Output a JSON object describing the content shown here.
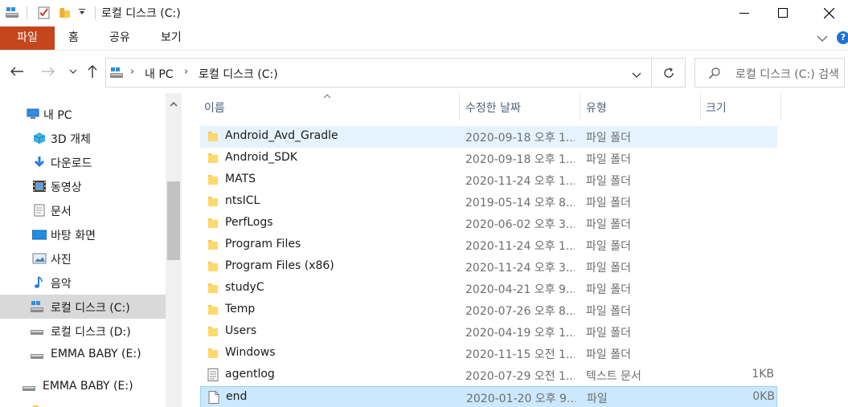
{
  "window": {
    "title": "로컬 디스크 (C:)",
    "accent_color": "#c5461c"
  },
  "ribbon": {
    "tabs": [
      "파일",
      "홈",
      "공유",
      "보기"
    ]
  },
  "address": {
    "breadcrumbs": [
      "내 PC",
      "로컬 디스크 (C:)"
    ],
    "search_placeholder": "로컬 디스크 (C:) 검색"
  },
  "nav": {
    "items": [
      {
        "label": "내 PC",
        "icon": "pc-icon"
      },
      {
        "label": "3D 개체",
        "icon": "3d-objects-icon"
      },
      {
        "label": "다운로드",
        "icon": "download-icon"
      },
      {
        "label": "동영상",
        "icon": "video-icon"
      },
      {
        "label": "문서",
        "icon": "document-icon"
      },
      {
        "label": "바탕 화면",
        "icon": "desktop-icon"
      },
      {
        "label": "사진",
        "icon": "picture-icon"
      },
      {
        "label": "음악",
        "icon": "music-icon"
      },
      {
        "label": "로컬 디스크 (C:)",
        "icon": "windows-drive-icon"
      },
      {
        "label": "로컬 디스크 (D:)",
        "icon": "drive-icon"
      },
      {
        "label": "EMMA BABY (E:)",
        "icon": "drive-icon"
      },
      {
        "label": "EMMA BABY (E:)",
        "icon": "drive-icon"
      }
    ]
  },
  "list": {
    "columns": [
      "이름",
      "수정한 날짜",
      "유형",
      "크기"
    ],
    "rows": [
      {
        "name": "Android_Avd_Gradle",
        "date": "2020-09-18 오후 1...",
        "type": "파일 폴더",
        "size": "",
        "icon": "folder-icon"
      },
      {
        "name": "Android_SDK",
        "date": "2020-09-18 오후 1...",
        "type": "파일 폴더",
        "size": "",
        "icon": "folder-icon"
      },
      {
        "name": "MATS",
        "date": "2020-11-24 오후 1...",
        "type": "파일 폴더",
        "size": "",
        "icon": "folder-icon"
      },
      {
        "name": "ntsICL",
        "date": "2019-05-14 오후 8...",
        "type": "파일 폴더",
        "size": "",
        "icon": "folder-icon"
      },
      {
        "name": "PerfLogs",
        "date": "2020-06-02 오후 3...",
        "type": "파일 폴더",
        "size": "",
        "icon": "folder-icon"
      },
      {
        "name": "Program Files",
        "date": "2020-11-24 오후 1...",
        "type": "파일 폴더",
        "size": "",
        "icon": "folder-icon"
      },
      {
        "name": "Program Files (x86)",
        "date": "2020-11-24 오후 3...",
        "type": "파일 폴더",
        "size": "",
        "icon": "folder-icon"
      },
      {
        "name": "studyC",
        "date": "2020-04-21 오후 9...",
        "type": "파일 폴더",
        "size": "",
        "icon": "folder-icon"
      },
      {
        "name": "Temp",
        "date": "2020-07-26 오후 8...",
        "type": "파일 폴더",
        "size": "",
        "icon": "folder-icon"
      },
      {
        "name": "Users",
        "date": "2020-04-19 오후 1...",
        "type": "파일 폴더",
        "size": "",
        "icon": "folder-icon"
      },
      {
        "name": "Windows",
        "date": "2020-11-15 오전 1...",
        "type": "파일 폴더",
        "size": "",
        "icon": "folder-icon"
      },
      {
        "name": "agentlog",
        "date": "2020-07-29 오전 1...",
        "type": "텍스트 문서",
        "size": "1KB",
        "icon": "text-file-icon"
      },
      {
        "name": "end",
        "date": "2020-01-20 오후 9...",
        "type": "파일",
        "size": "0KB",
        "icon": "file-icon"
      }
    ]
  }
}
